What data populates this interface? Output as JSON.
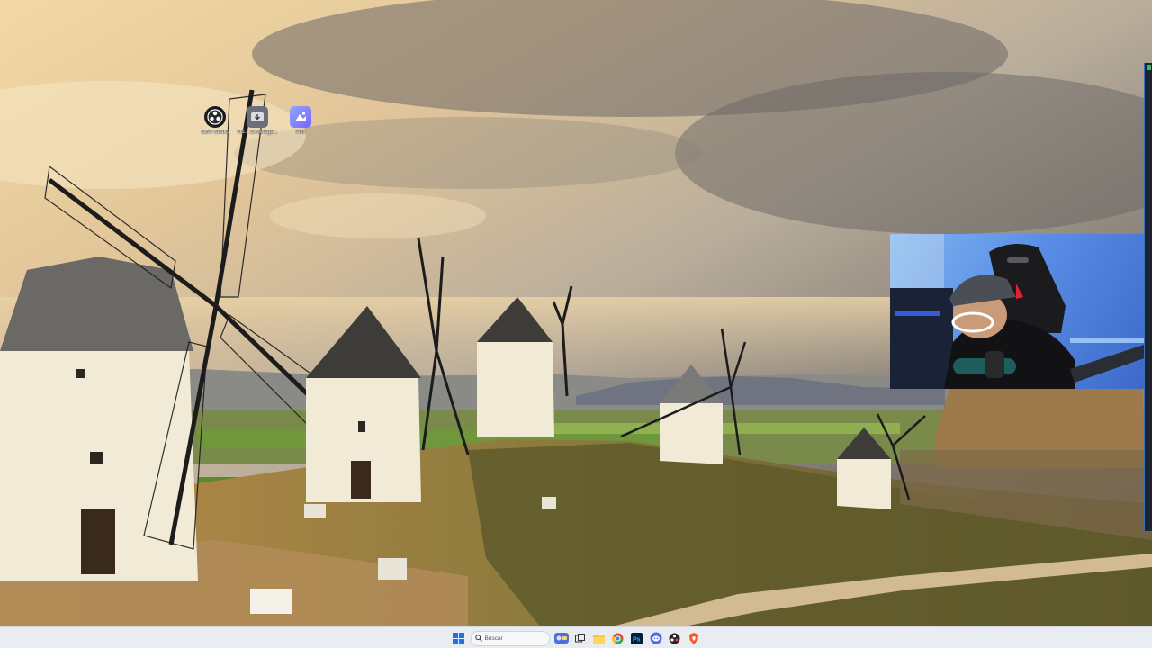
{
  "desktop": {
    "icons": [
      {
        "label": "OBS Studio",
        "icon": "obs-icon",
        "color": "#1b1b1b"
      },
      {
        "label": "Vid... Descarga...",
        "icon": "downloader-icon",
        "color": "#6b6f78"
      },
      {
        "label": "Pixlr",
        "icon": "pixlr-icon",
        "color": "#7b61ff"
      }
    ]
  },
  "webcam": {
    "description_icon": "webcam-feed"
  },
  "taskbar": {
    "search_placeholder": "Buscar",
    "apps": [
      {
        "name": "windows-start-icon",
        "color": "#1a73e8"
      },
      {
        "name": "search-icon"
      },
      {
        "name": "widgets-icon",
        "color": "#4a6fe0"
      },
      {
        "name": "task-view-icon",
        "color": "#333333"
      },
      {
        "name": "file-explorer-icon",
        "color": "#f4c03b"
      },
      {
        "name": "chrome-icon",
        "color": "#ea4335"
      },
      {
        "name": "photoshop-icon",
        "color": "#001e36"
      },
      {
        "name": "discord-icon",
        "color": "#5865f2"
      },
      {
        "name": "obs-taskbar-icon",
        "color": "#222222"
      },
      {
        "name": "brave-icon",
        "color": "#fb542b"
      }
    ]
  }
}
